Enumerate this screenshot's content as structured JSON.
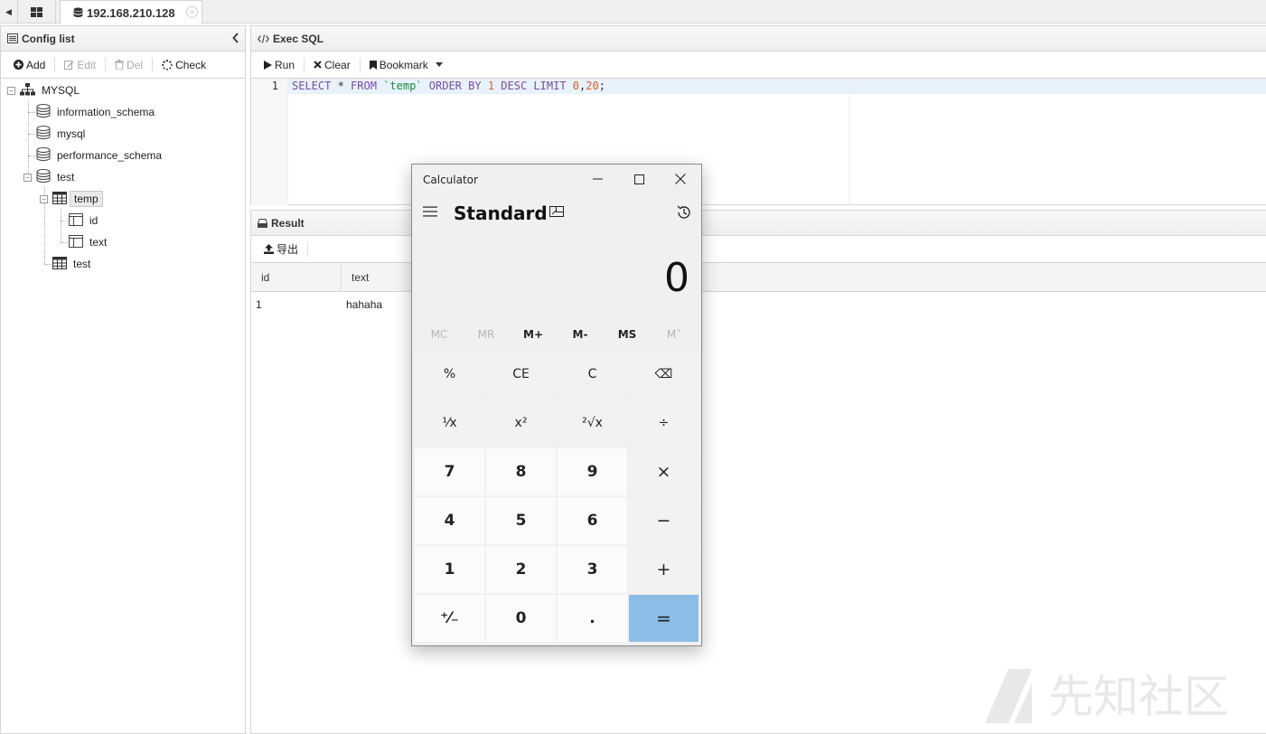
{
  "topbar": {
    "connection_tab": "192.168.210.128",
    "close_glyph": "×"
  },
  "left_panel": {
    "title": "Config list",
    "toolbar": {
      "add": "Add",
      "edit": "Edit",
      "del": "Del",
      "check": "Check"
    },
    "tree": {
      "root": "MYSQL",
      "db1": "information_schema",
      "db2": "mysql",
      "db3": "performance_schema",
      "db4": "test",
      "table1": "temp",
      "col1": "id",
      "col2": "text",
      "table2": "test"
    }
  },
  "exec_panel": {
    "title": "Exec SQL",
    "toolbar": {
      "run": "Run",
      "clear": "Clear",
      "bookmark": "Bookmark"
    },
    "line_number": "1",
    "sql": {
      "t1": "SELECT",
      "t2": " * ",
      "t3": "FROM",
      "t4": " ",
      "t5": "`temp`",
      "t6": " ",
      "t7": "ORDER BY",
      "t8": " ",
      "t9": "1",
      "t10": " ",
      "t11": "DESC",
      "t12": " ",
      "t13": "LIMIT",
      "t14": " ",
      "t15": "0",
      "t16": ",",
      "t17": "20",
      "t18": ";"
    }
  },
  "result_panel": {
    "title": "Result",
    "export_label": "导出",
    "columns": [
      "id",
      "text"
    ],
    "rows": [
      [
        "1",
        "hahaha"
      ]
    ]
  },
  "calculator": {
    "window_title": "Calculator",
    "mode": "Standard",
    "display": "0",
    "memory": [
      "MC",
      "MR",
      "M+",
      "M-",
      "MS",
      "M˅"
    ],
    "memory_enabled": [
      false,
      false,
      true,
      true,
      true,
      false
    ],
    "keys": [
      [
        "%",
        "CE",
        "C",
        "⌫"
      ],
      [
        "¹⁄x",
        "x²",
        "²√x",
        "÷"
      ],
      [
        "7",
        "8",
        "9",
        "×"
      ],
      [
        "4",
        "5",
        "6",
        "−"
      ],
      [
        "1",
        "2",
        "3",
        "+"
      ],
      [
        "⁺⁄₋",
        "0",
        ".",
        "="
      ]
    ],
    "equals_color": "#8bbde6"
  },
  "watermark": {
    "text": "先知社区"
  },
  "colors": {
    "keyword": "#7a4ba6",
    "string": "#1a8a3a",
    "number": "#d8602a",
    "selected_line": "#e8f2fb"
  }
}
